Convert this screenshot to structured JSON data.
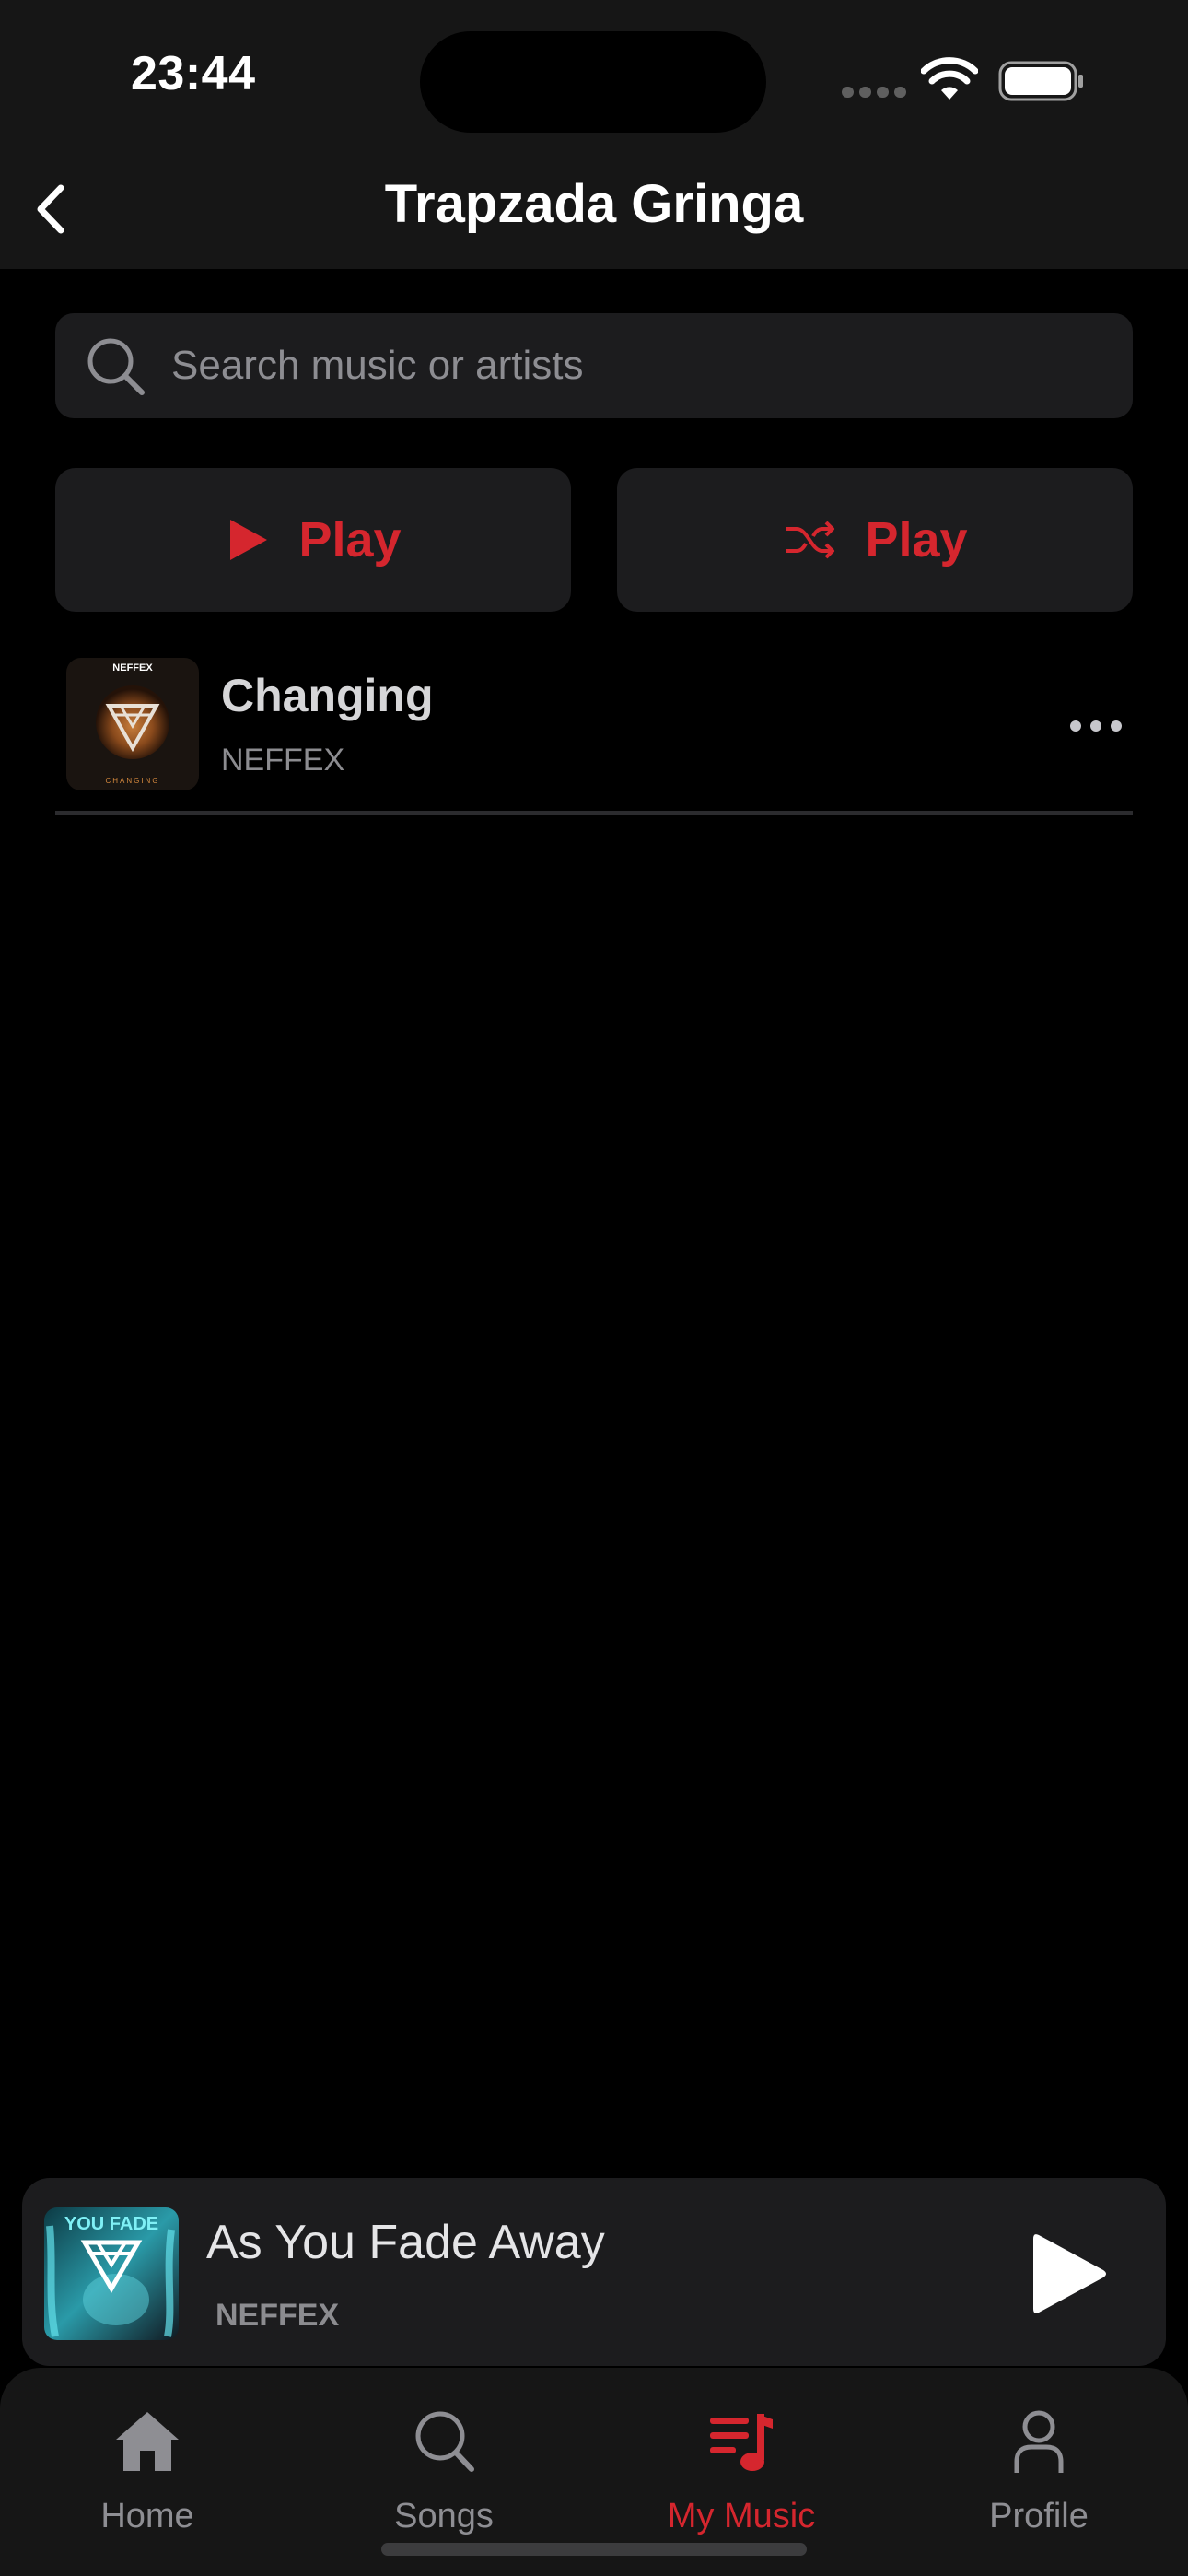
{
  "status_bar": {
    "time": "23:44"
  },
  "header": {
    "title": "Trapzada Gringa",
    "back_icon": "chevron-left-icon"
  },
  "search": {
    "placeholder": "Search music or artists",
    "icon": "magnifier-icon"
  },
  "actions": {
    "play_label": "Play",
    "shuffle_play_label": "Play"
  },
  "songs": [
    {
      "title": "Changing",
      "artist": "NEFFEX",
      "cover_text_top": "NEFFEX",
      "cover_text_bottom": "CHANGING"
    }
  ],
  "mini_player": {
    "title": "As You Fade Away",
    "artist": "NEFFEX",
    "cover_text": "YOU FADE"
  },
  "tabs": [
    {
      "label": "Home",
      "icon": "home-icon",
      "active": false
    },
    {
      "label": "Songs",
      "icon": "search-icon",
      "active": false
    },
    {
      "label": "My Music",
      "icon": "music-list-icon",
      "active": true
    },
    {
      "label": "Profile",
      "icon": "person-icon",
      "active": false
    }
  ],
  "colors": {
    "accent": "#d5262e",
    "background": "#000000",
    "surface": "#1c1c1e",
    "header": "#161616",
    "inactive": "#8e8e93"
  }
}
